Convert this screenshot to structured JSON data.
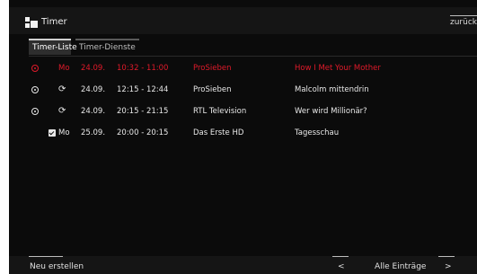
{
  "header": {
    "title": "Timer",
    "back_label": "zurück"
  },
  "tabs": [
    {
      "label": "Timer-Liste",
      "active": true
    },
    {
      "label": "Timer-Dienste",
      "active": false
    }
  ],
  "timers": [
    {
      "status": "recording",
      "day": "Mo",
      "date": "24.09.",
      "time": "10:32 - 11:00",
      "channel": "ProSieben",
      "title": "How I Met Your Mother"
    },
    {
      "status": "repeat",
      "day": "",
      "date": "24.09.",
      "time": "12:15 - 12:44",
      "channel": "ProSieben",
      "title": "Malcolm mittendrin"
    },
    {
      "status": "repeat",
      "day": "",
      "date": "24.09.",
      "time": "20:15 - 21:15",
      "channel": "RTL Television",
      "title": "Wer wird Millionär?"
    },
    {
      "status": "checked",
      "day": "Mo",
      "date": "25.09.",
      "time": "20:00 - 20:15",
      "channel": "Das Erste HD",
      "title": "Tagesschau"
    }
  ],
  "footer": {
    "new_label": "Neu erstellen",
    "prev_label": "<",
    "filter_label": "Alle Einträge",
    "next_label": ">"
  },
  "colors": {
    "recording": "#e01a2a",
    "background": "#0b0b0b"
  }
}
